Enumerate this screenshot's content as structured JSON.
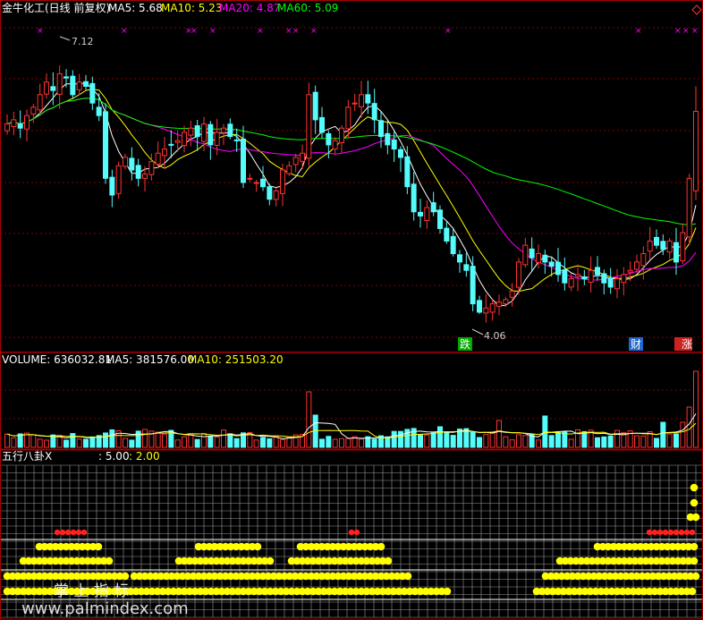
{
  "price_panel": {
    "title": "金牛化工(日线 前复权)",
    "ma5_label": "MA5: 5.68",
    "ma10_label": "MA10: 5.23",
    "ma20_label": "MA20: 4.87",
    "ma60_label": "MA60: 5.09",
    "high_label": "7.12",
    "low_label": "4.06",
    "signal_down": "跌",
    "signal_wealth": "财",
    "signal_surge": "涨"
  },
  "volume_panel": {
    "vol_label": "VOLUME: 636032.81",
    "ma5_label": "MA5: 381576.00",
    "ma10_label": "MA10: 251503.20"
  },
  "indicator_panel": {
    "name": "五行八卦X",
    "value_a": ": 5.00",
    "value_b": ": 2.00"
  },
  "watermark": {
    "text": "掌 上 指 标",
    "url": "www.palmindex.com"
  },
  "colors": {
    "up": "#ff3232",
    "down": "#54fcfc",
    "ma5": "#ffffff",
    "ma10": "#ffff00",
    "ma20": "#ff00ff",
    "ma60": "#00ff00",
    "panel_border": "#aa0000",
    "grid": "#800000",
    "dot": "#ffff00"
  },
  "chart_data": {
    "type": "candlestick",
    "ylim": [
      3.8,
      7.5
    ],
    "closes": [
      6.35,
      6.4,
      6.3,
      6.45,
      6.55,
      6.7,
      6.85,
      6.75,
      6.95,
      6.9,
      6.7,
      6.85,
      6.8,
      6.6,
      6.45,
      5.7,
      5.5,
      5.85,
      5.95,
      5.8,
      5.7,
      5.75,
      5.9,
      6.0,
      6.05,
      6.1,
      6.15,
      6.25,
      6.3,
      6.2,
      6.35,
      6.1,
      6.25,
      6.3,
      6.2,
      6.15,
      5.65,
      5.7,
      5.65,
      5.6,
      5.45,
      5.55,
      5.8,
      5.85,
      5.95,
      6.0,
      6.7,
      6.4,
      6.25,
      6.1,
      6.15,
      6.3,
      6.55,
      6.6,
      6.7,
      6.6,
      6.4,
      6.2,
      6.1,
      6.05,
      5.95,
      5.6,
      5.3,
      5.25,
      5.35,
      5.3,
      5.1,
      4.95,
      4.8,
      4.7,
      4.6,
      4.2,
      4.1,
      4.15,
      4.2,
      4.22,
      4.25,
      4.35,
      4.7,
      4.9,
      4.75,
      4.8,
      4.7,
      4.65,
      4.55,
      4.45,
      4.5,
      4.55,
      4.5,
      4.6,
      4.55,
      4.45,
      4.4,
      4.5,
      4.55,
      4.6,
      4.7,
      4.8,
      4.95,
      4.9,
      4.85,
      4.95,
      4.7,
      5.05,
      5.7,
      6.5
    ]
  },
  "indicator_rows": [
    {
      "y": 545,
      "segments": [
        [
          776,
          778
        ]
      ]
    },
    {
      "y": 562,
      "segments": [
        [
          776,
          778
        ]
      ]
    },
    {
      "y": 578,
      "segments": [
        [
          772,
          778
        ]
      ]
    },
    {
      "y": 595,
      "color": "#ff2020",
      "segments": [
        [
          64,
          96
        ],
        [
          393,
          403
        ],
        [
          726,
          778
        ]
      ]
    },
    {
      "y": 611,
      "segments": [
        [
          44,
          112
        ],
        [
          222,
          290
        ],
        [
          336,
          426
        ],
        [
          668,
          778
        ]
      ]
    },
    {
      "y": 627,
      "segments": [
        [
          26,
          124
        ],
        [
          200,
          302
        ],
        [
          326,
          436
        ],
        [
          626,
          778
        ]
      ]
    },
    {
      "y": 644,
      "segments": [
        [
          8,
          140
        ],
        [
          150,
          460
        ],
        [
          610,
          778
        ]
      ]
    },
    {
      "y": 661,
      "segments": [
        [
          8,
          500
        ],
        [
          600,
          778
        ]
      ]
    }
  ]
}
